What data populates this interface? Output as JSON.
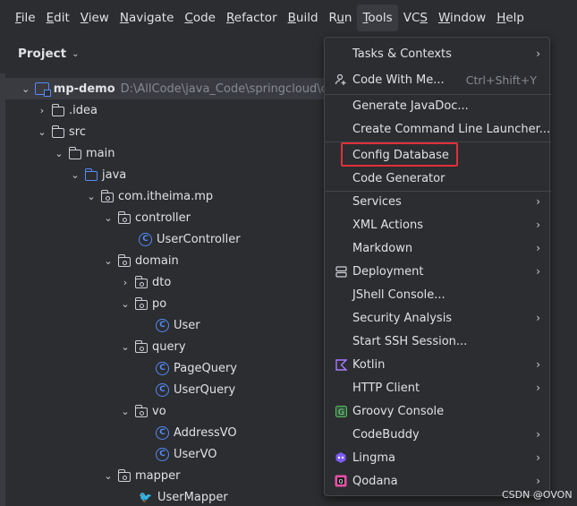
{
  "menubar": {
    "items": [
      {
        "label": "File",
        "mnemonic": "F"
      },
      {
        "label": "Edit",
        "mnemonic": "E"
      },
      {
        "label": "View",
        "mnemonic": "V"
      },
      {
        "label": "Navigate",
        "mnemonic": "N"
      },
      {
        "label": "Code",
        "mnemonic": "C"
      },
      {
        "label": "Refactor",
        "mnemonic": "R"
      },
      {
        "label": "Build",
        "mnemonic": "B"
      },
      {
        "label": "Run",
        "mnemonic": "u"
      },
      {
        "label": "Tools",
        "mnemonic": "T"
      },
      {
        "label": "VCS",
        "mnemonic": "S"
      },
      {
        "label": "Window",
        "mnemonic": "W"
      },
      {
        "label": "Help",
        "mnemonic": "H"
      }
    ]
  },
  "project": {
    "header": "Project",
    "tree": [
      {
        "label": "mp-demo",
        "path": "D:\\AllCode\\java_Code\\springcloud\\code",
        "type": "module"
      },
      {
        "label": ".idea",
        "type": "folder"
      },
      {
        "label": "src",
        "type": "folder"
      },
      {
        "label": "main",
        "type": "folder"
      },
      {
        "label": "java",
        "type": "folder-blue"
      },
      {
        "label": "com.itheima.mp",
        "type": "package"
      },
      {
        "label": "controller",
        "type": "package"
      },
      {
        "label": "UserController",
        "type": "class"
      },
      {
        "label": "domain",
        "type": "package"
      },
      {
        "label": "dto",
        "type": "package"
      },
      {
        "label": "po",
        "type": "package"
      },
      {
        "label": "User",
        "type": "class"
      },
      {
        "label": "query",
        "type": "package"
      },
      {
        "label": "PageQuery",
        "type": "class"
      },
      {
        "label": "UserQuery",
        "type": "class"
      },
      {
        "label": "vo",
        "type": "package"
      },
      {
        "label": "AddressVO",
        "type": "class"
      },
      {
        "label": "UserVO",
        "type": "class"
      },
      {
        "label": "mapper",
        "type": "package"
      },
      {
        "label": "UserMapper",
        "type": "mapper"
      }
    ]
  },
  "tools_menu": {
    "items": [
      {
        "label": "Tasks & Contexts",
        "submenu": true
      },
      {
        "label": "Code With Me...",
        "shortcut": "Ctrl+Shift+Y",
        "icon": "person-add-icon"
      },
      {
        "label": "Generate JavaDoc..."
      },
      {
        "label": "Create Command Line Launcher..."
      },
      {
        "label": "Config Database",
        "highlighted": true
      },
      {
        "label": "Code Generator"
      },
      {
        "label": "Services",
        "submenu": true
      },
      {
        "label": "XML Actions",
        "submenu": true
      },
      {
        "label": "Markdown",
        "submenu": true
      },
      {
        "label": "Deployment",
        "submenu": true,
        "icon": "deployment-icon"
      },
      {
        "label": "JShell Console..."
      },
      {
        "label": "Security Analysis",
        "submenu": true
      },
      {
        "label": "Start SSH Session..."
      },
      {
        "label": "Kotlin",
        "submenu": true,
        "icon": "kotlin-icon"
      },
      {
        "label": "HTTP Client",
        "submenu": true
      },
      {
        "label": "Groovy Console",
        "icon": "groovy-icon"
      },
      {
        "label": "CodeBuddy",
        "submenu": true
      },
      {
        "label": "Lingma",
        "submenu": true,
        "icon": "lingma-icon"
      },
      {
        "label": "Qodana",
        "submenu": true,
        "icon": "qodana-icon"
      }
    ]
  },
  "watermark": "CSDN @OVON",
  "colors": {
    "accent": "#548af7",
    "highlight": "#e0303a",
    "background": "#2b2d30"
  }
}
